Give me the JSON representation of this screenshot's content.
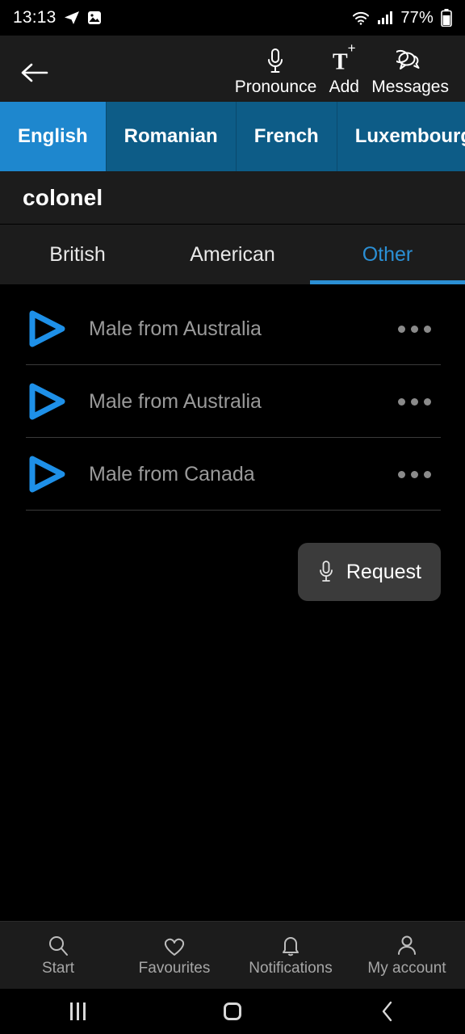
{
  "status_bar": {
    "time": "13:13",
    "battery_percent": "77%",
    "icons": [
      "telegram-icon",
      "image-icon",
      "wifi-icon",
      "cellular-signal-icon",
      "battery-icon"
    ]
  },
  "toolbar": {
    "back_icon": "back-arrow-icon",
    "actions": [
      {
        "label": "Pronounce",
        "icon": "microphone-icon"
      },
      {
        "label": "Add",
        "icon": "add-text-icon"
      },
      {
        "label": "Messages",
        "icon": "messages-icon"
      }
    ]
  },
  "language_tabs": {
    "selected": "English",
    "items": [
      {
        "label": "English"
      },
      {
        "label": "Romanian"
      },
      {
        "label": "French"
      },
      {
        "label": "Luxembourgish"
      }
    ]
  },
  "word": {
    "text": "colonel"
  },
  "accent_tabs": {
    "selected": "Other",
    "items": [
      {
        "label": "British"
      },
      {
        "label": "American"
      },
      {
        "label": "Other"
      }
    ]
  },
  "pronunciations": [
    {
      "label": "Male from Australia",
      "play_icon": "play-triangle-icon",
      "more_icon": "more-options-icon"
    },
    {
      "label": "Male from Australia",
      "play_icon": "play-triangle-icon",
      "more_icon": "more-options-icon"
    },
    {
      "label": "Male from Canada",
      "play_icon": "play-triangle-icon",
      "more_icon": "more-options-icon"
    }
  ],
  "request": {
    "label": "Request",
    "icon": "microphone-icon"
  },
  "bottom_nav": {
    "items": [
      {
        "label": "Start",
        "icon": "search-icon"
      },
      {
        "label": "Favourites",
        "icon": "heart-icon"
      },
      {
        "label": "Notifications",
        "icon": "bell-icon"
      },
      {
        "label": "My account",
        "icon": "person-icon"
      }
    ]
  },
  "system_nav": {
    "items": [
      {
        "icon": "recents-icon"
      },
      {
        "icon": "home-icon"
      },
      {
        "icon": "back-icon"
      }
    ]
  },
  "colors": {
    "accent_blue": "#2b8fd4",
    "tab_active_blue": "#1e87ce",
    "tab_inactive_blue": "#0d5c87",
    "surface": "#1c1c1c",
    "background": "#000000",
    "muted_text": "#9a9a9a"
  }
}
